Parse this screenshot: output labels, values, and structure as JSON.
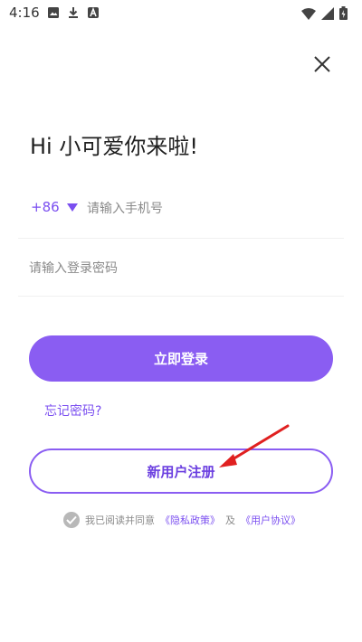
{
  "status_bar": {
    "time": "4:16",
    "left_icons": [
      "image-icon",
      "download-icon",
      "app-icon"
    ],
    "right_icons": [
      "wifi-icon",
      "signal-icon",
      "battery-icon"
    ]
  },
  "greeting": "Hi 小可爱你来啦!",
  "phone": {
    "country_code": "+86",
    "placeholder": "请输入手机号",
    "value": ""
  },
  "password": {
    "placeholder": "请输入登录密码",
    "value": ""
  },
  "login_button": "立即登录",
  "forgot_password": "忘记密码?",
  "register_button": "新用户注册",
  "agreement": {
    "prefix": "我已阅读并同意",
    "privacy_policy": "《隐私政策》",
    "and": "及",
    "user_agreement": "《用户协议》",
    "checked": true
  },
  "colors": {
    "accent": "#8a5df2",
    "accent_text": "#7b4ff0",
    "annotation_arrow": "#e02020"
  }
}
